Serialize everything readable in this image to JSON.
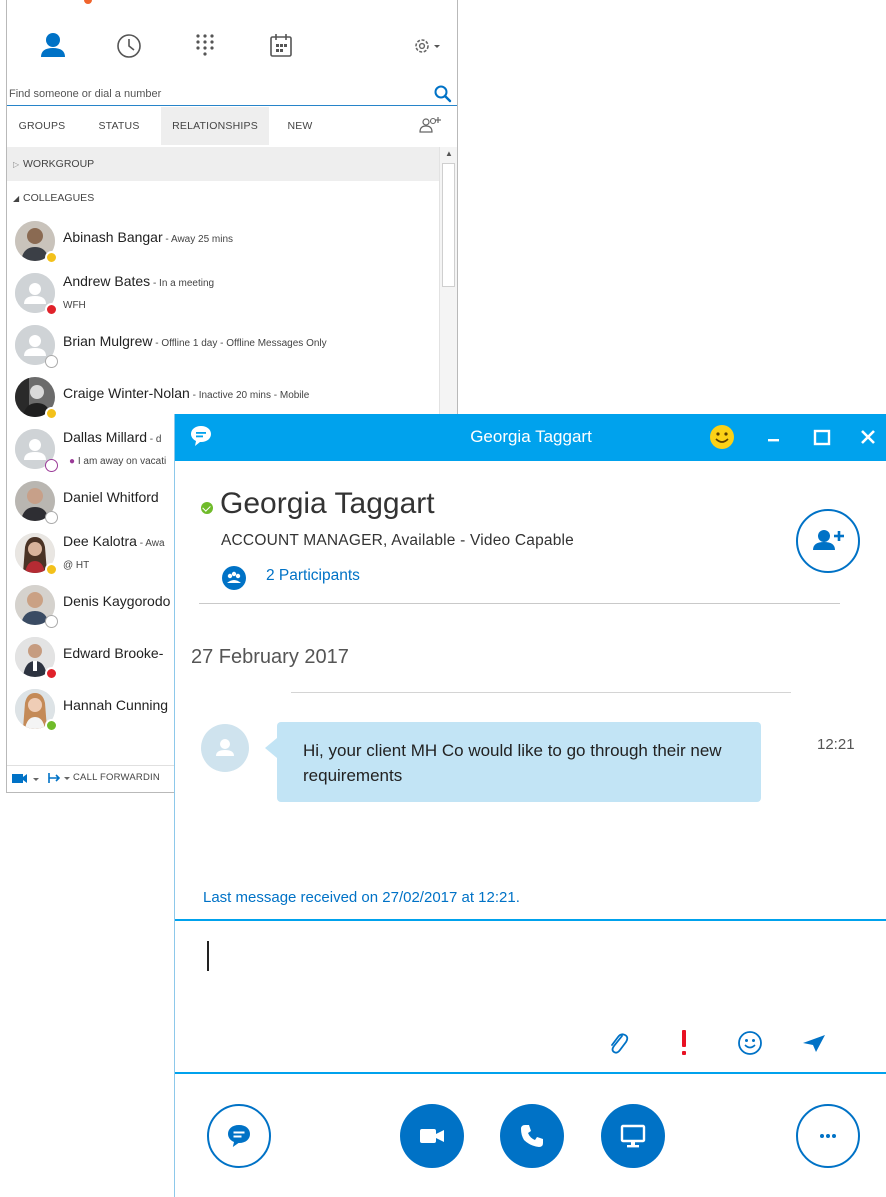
{
  "contacts_window": {
    "search": {
      "placeholder": "Find someone or dial a number"
    },
    "tabs": [
      {
        "label": "GROUPS"
      },
      {
        "label": "STATUS"
      },
      {
        "label": "RELATIONSHIPS",
        "active": true
      },
      {
        "label": "NEW"
      }
    ],
    "groups": [
      {
        "label": "WORKGROUP",
        "expanded": false
      },
      {
        "label": "COLLEAGUES",
        "expanded": true
      }
    ],
    "contacts": [
      {
        "name": "Abinash Bangar",
        "status": " - Away 25 mins",
        "note": "",
        "presence": "away"
      },
      {
        "name": "Andrew Bates",
        "status": " - In a meeting",
        "note": "WFH",
        "presence": "busy"
      },
      {
        "name": "Brian Mulgrew",
        "status": " - Offline 1 day - Offline Messages Only",
        "note": "",
        "presence": "offline"
      },
      {
        "name": "Craige Winter-Nolan",
        "status": " - Inactive 20 mins - Mobile",
        "note": "",
        "presence": "away"
      },
      {
        "name": "Dallas Millard",
        "status": " - d",
        "note": "I am away on vacati",
        "presence": "oof"
      },
      {
        "name": "Daniel Whitford",
        "status": "",
        "note": "",
        "presence": "offline"
      },
      {
        "name": "Dee Kalotra",
        "status": " - Awa",
        "note": "@ HT",
        "presence": "away"
      },
      {
        "name": "Denis Kaygorodo",
        "status": "",
        "note": "",
        "presence": "offline"
      },
      {
        "name": "Edward Brooke-",
        "status": "",
        "note": "",
        "presence": "busy"
      },
      {
        "name": "Hannah Cunning",
        "status": "",
        "note": "",
        "presence": "avail"
      }
    ],
    "footer": {
      "call_forwarding": "CALL FORWARDIN"
    }
  },
  "conversation": {
    "title": "Georgia Taggart",
    "contact_name": "Georgia Taggart",
    "contact_subtitle": "ACCOUNT MANAGER,  Available - Video Capable",
    "participants": "2 Participants",
    "date": "27 February 2017",
    "message": {
      "text": "Hi, your client MH Co would like to go through their new requirements",
      "time": "12:21"
    },
    "last_message_notice": "Last message received on 27/02/2017 at 12:21."
  },
  "colors": {
    "titlebar": "#00a2ed",
    "accent": "#0072c6",
    "bubble": "#c2e4f5",
    "available": "#6fbb2a",
    "away": "#f3c11b",
    "busy": "#e0222a",
    "important": "#e81123"
  },
  "icons": [
    "contacts-icon",
    "clock-icon",
    "dialpad-icon",
    "calendar-icon",
    "settings-icon",
    "search-icon",
    "add-group-icon",
    "chat-icon",
    "emoji-icon",
    "minimize-icon",
    "maximize-icon",
    "close-icon",
    "participants-icon",
    "add-person-icon",
    "attach-icon",
    "important-icon",
    "send-icon",
    "video-icon",
    "phone-icon",
    "screen-share-icon",
    "more-icon"
  ]
}
